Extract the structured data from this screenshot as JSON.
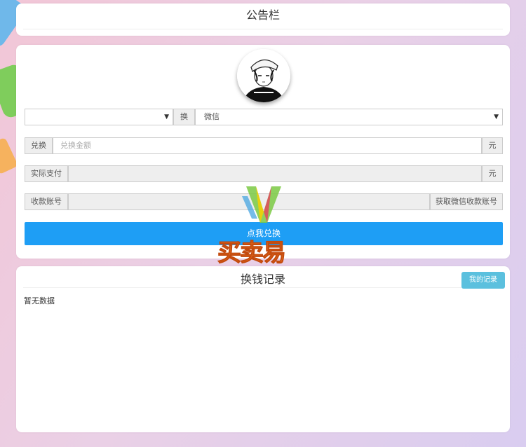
{
  "notice": {
    "title": "公告栏"
  },
  "form": {
    "from_select": {
      "value": ""
    },
    "swap_label": "换",
    "to_select": {
      "value": "微信"
    },
    "amount": {
      "label": "兑换",
      "placeholder": "兑换金额",
      "unit": "元"
    },
    "actual_pay": {
      "label": "实际支付",
      "value": "",
      "unit": "元"
    },
    "account": {
      "label": "收款账号",
      "value": "",
      "button": "获取微信收款账号"
    },
    "submit_label": "点我兑换"
  },
  "records": {
    "title": "换钱记录",
    "my_records_button": "我的记录",
    "empty_text": "暂无数据"
  },
  "watermark": {
    "text": "买卖易"
  },
  "colors": {
    "primary": "#1e9ef5",
    "info": "#5bc0de",
    "watermark": "#f37b21"
  }
}
